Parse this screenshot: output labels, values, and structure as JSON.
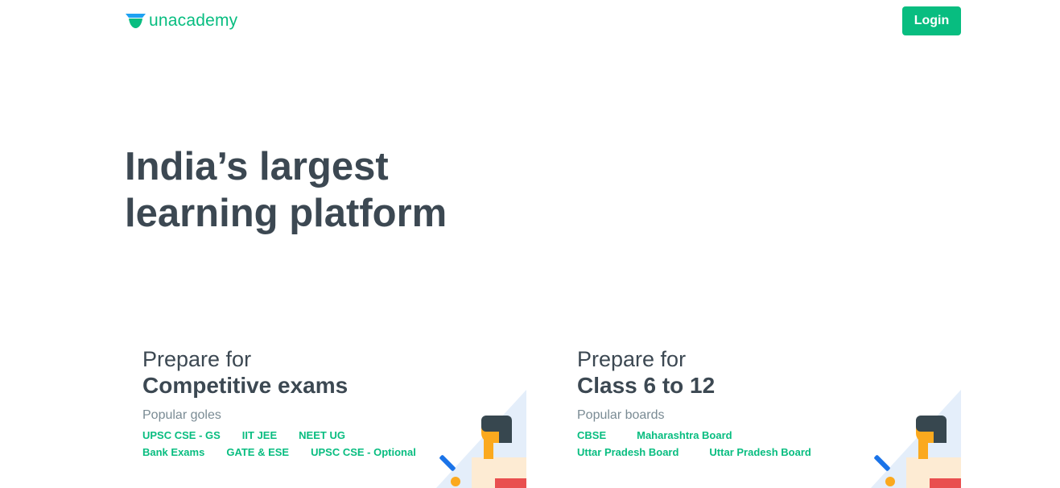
{
  "header": {
    "logo_text": "unacademy",
    "login_label": "Login"
  },
  "hero": {
    "line1": "India’s largest",
    "line2": "learning platform"
  },
  "cards": [
    {
      "prep": "Prepare for",
      "title": "Competitive exams",
      "subtitle": "Popular goles",
      "links": [
        "UPSC CSE - GS",
        "IIT JEE",
        "NEET UG",
        "Bank Exams",
        "GATE & ESE",
        "UPSC CSE - Optional"
      ]
    },
    {
      "prep": "Prepare for",
      "title": "Class 6 to 12",
      "subtitle": "Popular boards",
      "links": [
        "CBSE",
        "Maharashtra Board",
        "Uttar Pradesh Board",
        "Uttar Pradesh Board"
      ]
    }
  ],
  "colors": {
    "brand": "#08bd80",
    "text": "#3c4852",
    "muted": "#7a8b94"
  }
}
